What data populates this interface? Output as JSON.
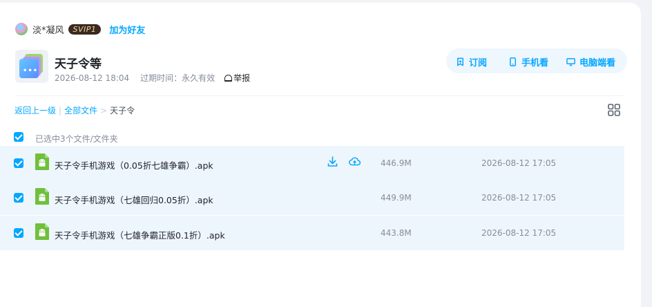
{
  "user": {
    "name": "淡*凝风",
    "badge": "SVIP1",
    "add_friend": "加为好友"
  },
  "share": {
    "title": "天子令等",
    "date": "2026-08-12 18:04",
    "expire_label": "过期时间：",
    "expire_value": "永久有效",
    "report": "举报"
  },
  "actions": {
    "subscribe": "订阅",
    "phone": "手机看",
    "pc": "电脑端看"
  },
  "breadcrumb": {
    "back": "返回上一级",
    "sep1": "|",
    "all_files": "全部文件",
    "sep2": ">",
    "current": "天子令"
  },
  "selection": {
    "text": "已选中3个文件/文件夹"
  },
  "files": [
    {
      "name": "天子令手机游戏（0.05折七雄争霸）.apk",
      "size": "446.9M",
      "time": "2026-08-12 17:05"
    },
    {
      "name": "天子令手机游戏（七雄回归0.05折）.apk",
      "size": "449.9M",
      "time": "2026-08-12 17:05"
    },
    {
      "name": "天子令手机游戏（七雄争霸正版0.1折）.apk",
      "size": "443.8M",
      "time": "2026-08-12 17:05"
    }
  ],
  "icons": {
    "avatar": "avatar-icon",
    "share": "share-folder-icon",
    "report": "report-icon",
    "subscribe": "subscribe-icon",
    "phone": "phone-icon",
    "pc": "monitor-icon",
    "grid": "grid-view-icon",
    "apk": "android-apk-icon",
    "download": "download-icon",
    "cloud": "cloud-save-icon"
  },
  "colors": {
    "accent": "#06a7ff",
    "selected_row": "#eef6fd",
    "apk_green": "#6fc03c"
  }
}
